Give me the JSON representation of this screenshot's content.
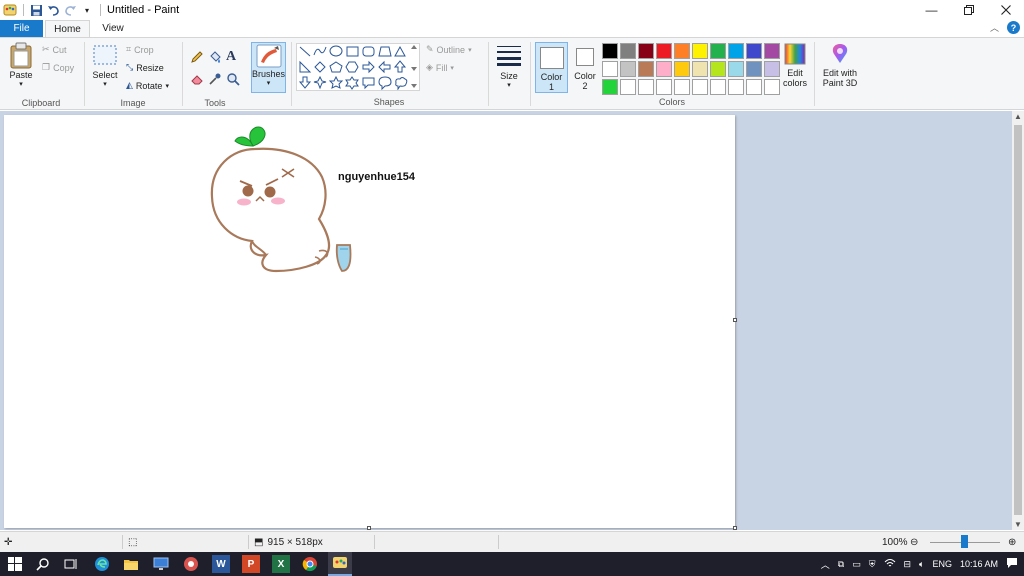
{
  "window": {
    "title": "Untitled - Paint"
  },
  "tabs": {
    "file": "File",
    "home": "Home",
    "view": "View"
  },
  "clipboard": {
    "paste": "Paste",
    "cut": "Cut",
    "copy": "Copy",
    "label": "Clipboard"
  },
  "image": {
    "select": "Select",
    "crop": "Crop",
    "resize": "Resize",
    "rotate": "Rotate",
    "label": "Image"
  },
  "tools": {
    "label": "Tools",
    "brushes": "Brushes"
  },
  "shapes": {
    "outline": "Outline",
    "fill": "Fill",
    "label": "Shapes",
    "size": "Size"
  },
  "colors": {
    "color1": "Color",
    "color1_num": "1",
    "color2": "Color",
    "color2_num": "2",
    "edit_colors_1": "Edit",
    "edit_colors_2": "colors",
    "edit_3d_1": "Edit with",
    "edit_3d_2": "Paint 3D",
    "label": "Colors",
    "palette": [
      "#000000",
      "#7f7f7f",
      "#880015",
      "#ed1c24",
      "#ff7f27",
      "#fff200",
      "#22b14c",
      "#00a2e8",
      "#3f48cc",
      "#a349a4",
      "#ffffff",
      "#c3c3c3",
      "#b97a57",
      "#ffaec9",
      "#ffc90e",
      "#efe4b0",
      "#b5e61d",
      "#99d9ea",
      "#7092be",
      "#c8bfe7",
      "#22d33a",
      "#ffffff",
      "#ffffff",
      "#ffffff",
      "#ffffff",
      "#ffffff",
      "#ffffff",
      "#ffffff",
      "#ffffff",
      "#ffffff"
    ]
  },
  "canvas": {
    "signature": "nguyenhue154"
  },
  "status": {
    "dimensions": "915 × 518px",
    "zoom": "100%",
    "zoom_level": 0.48
  },
  "taskbar": {
    "lang": "ENG",
    "time": "10:16 AM"
  }
}
